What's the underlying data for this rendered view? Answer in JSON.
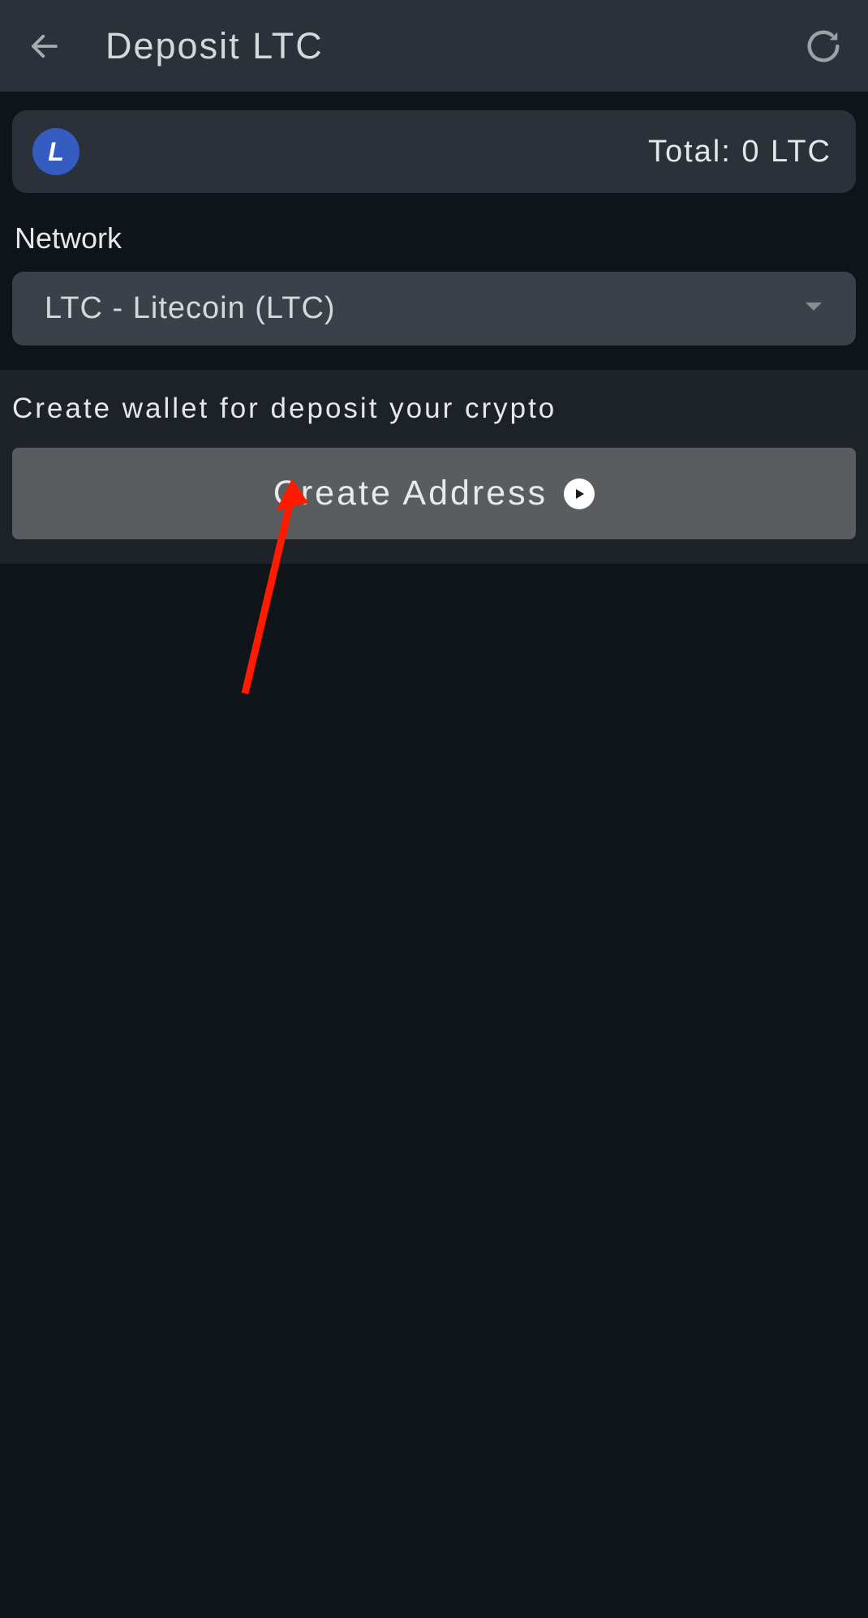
{
  "header": {
    "title": "Deposit LTC"
  },
  "balance": {
    "coin_symbol": "L",
    "total_text": "Total: 0 LTC"
  },
  "network": {
    "label": "Network",
    "selected": "LTC - Litecoin (LTC)"
  },
  "create": {
    "description": "Create wallet for deposit your crypto",
    "button_label": "Create Address"
  }
}
